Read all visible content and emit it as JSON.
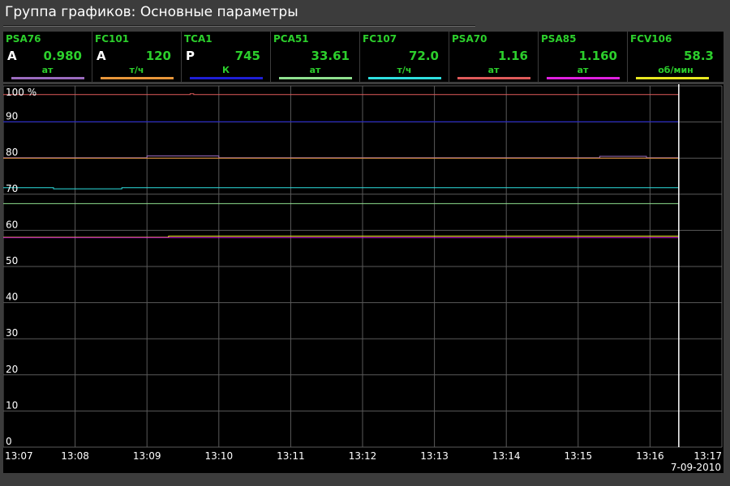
{
  "title": "Группа графиков: Основные параметры",
  "panels": [
    {
      "name": "PSA76",
      "mode": "A",
      "value": "0.980",
      "unit": "ат",
      "color": "#9b6bbf"
    },
    {
      "name": "FC101",
      "mode": "A",
      "value": "120",
      "unit": "т/ч",
      "color": "#e8963a"
    },
    {
      "name": "TCA1",
      "mode": "P",
      "value": "745",
      "unit": "К",
      "color": "#1e1ed6"
    },
    {
      "name": "PCA51",
      "mode": "",
      "value": "33.61",
      "unit": "ат",
      "color": "#8fe08f"
    },
    {
      "name": "FC107",
      "mode": "",
      "value": "72.0",
      "unit": "т/ч",
      "color": "#2ee0e0"
    },
    {
      "name": "PSA70",
      "mode": "",
      "value": "1.16",
      "unit": "ат",
      "color": "#e05a5a"
    },
    {
      "name": "PSA85",
      "mode": "",
      "value": "1.160",
      "unit": "ат",
      "color": "#e020e0"
    },
    {
      "name": "FCV106",
      "mode": "",
      "value": "58.3",
      "unit": "об/мин",
      "color": "#e8e820"
    }
  ],
  "chart_data": {
    "type": "line",
    "ylim": [
      0,
      100
    ],
    "y_ticks": [
      "0",
      "10",
      "20",
      "30",
      "40",
      "50",
      "60",
      "70",
      "80",
      "90",
      "100 %"
    ],
    "y_tick_values": [
      0,
      10,
      20,
      30,
      40,
      50,
      60,
      70,
      80,
      90,
      100
    ],
    "x_ticks": [
      "13:07",
      "13:08",
      "13:09",
      "13:10",
      "13:11",
      "13:12",
      "13:13",
      "13:14",
      "13:15",
      "13:16",
      "13:17"
    ],
    "x_range_minutes": [
      0,
      10
    ],
    "cursor_minute": 9.4,
    "date": "7-09-2010",
    "grid": true,
    "series": [
      {
        "name": "PSA70",
        "color": "#e05a5a",
        "points": [
          [
            0,
            97.6
          ],
          [
            2.6,
            97.6
          ],
          [
            2.6,
            97.8
          ],
          [
            2.65,
            97.8
          ],
          [
            2.65,
            97.6
          ],
          [
            9.4,
            97.6
          ]
        ]
      },
      {
        "name": "TCA1",
        "color": "#1e1ed6",
        "points": [
          [
            0,
            90.1
          ],
          [
            9.4,
            90.1
          ]
        ]
      },
      {
        "name": "PSA76",
        "color": "#9b6bbf",
        "points": [
          [
            0,
            80.1
          ],
          [
            2.0,
            80.1
          ],
          [
            2.0,
            80.6
          ],
          [
            3.0,
            80.6
          ],
          [
            3.0,
            80.1
          ],
          [
            8.3,
            80.1
          ],
          [
            8.3,
            80.5
          ],
          [
            8.95,
            80.5
          ],
          [
            8.95,
            80.1
          ],
          [
            9.4,
            80.1
          ]
        ]
      },
      {
        "name": "FC101",
        "color": "#e8963a",
        "points": [
          [
            0,
            80.0
          ],
          [
            9.4,
            80.0
          ]
        ]
      },
      {
        "name": "FC107",
        "color": "#2ee0e0",
        "points": [
          [
            0,
            71.8
          ],
          [
            0.7,
            71.8
          ],
          [
            0.7,
            71.5
          ],
          [
            1.65,
            71.5
          ],
          [
            1.65,
            71.8
          ],
          [
            9.4,
            71.8
          ]
        ]
      },
      {
        "name": "PCA51",
        "color": "#8fe08f",
        "points": [
          [
            0,
            67.4
          ],
          [
            9.4,
            67.4
          ]
        ]
      },
      {
        "name": "FCV106",
        "color": "#e8e820",
        "points": [
          [
            0,
            58.1
          ],
          [
            2.3,
            58.1
          ],
          [
            2.3,
            58.4
          ],
          [
            9.4,
            58.4
          ]
        ]
      },
      {
        "name": "PSA85",
        "color": "#e020e0",
        "points": [
          [
            0,
            58.0
          ],
          [
            9.4,
            58.0
          ]
        ]
      }
    ]
  }
}
